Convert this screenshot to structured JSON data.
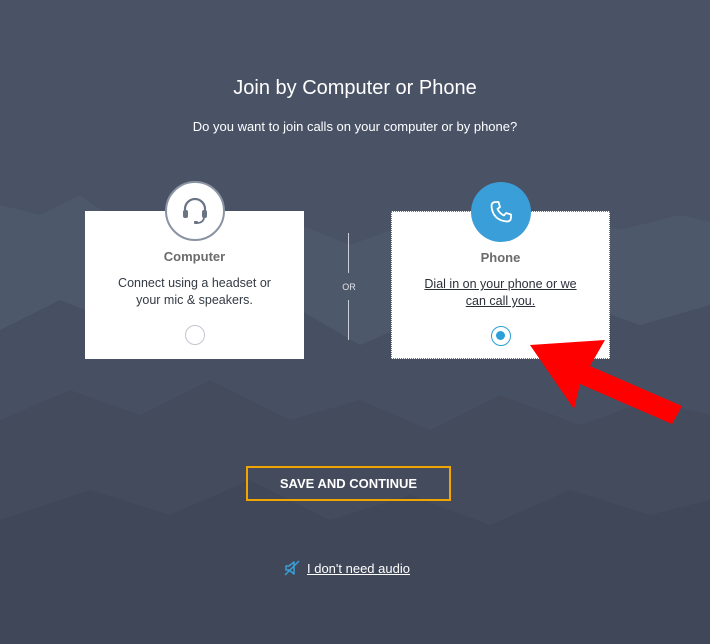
{
  "dialog": {
    "title": "Join by Computer or Phone",
    "subtitle": "Do you want to join calls on your computer or by phone?"
  },
  "options": [
    {
      "id": "computer",
      "title": "Computer",
      "description": "Connect using a headset or your mic & speakers.",
      "icon": "headset-icon",
      "selected": false
    },
    {
      "id": "phone",
      "title": "Phone",
      "description": "Dial in on your phone or we can call you.",
      "icon": "phone-icon",
      "selected": true
    }
  ],
  "divider_label": "OR",
  "save_button": "SAVE AND CONTINUE",
  "no_audio_link": "I don't need audio",
  "colors": {
    "background": "#4a5366",
    "accent_blue": "#3a9fd8",
    "button_border": "#f0a500",
    "annotation_arrow": "#ff0000"
  }
}
